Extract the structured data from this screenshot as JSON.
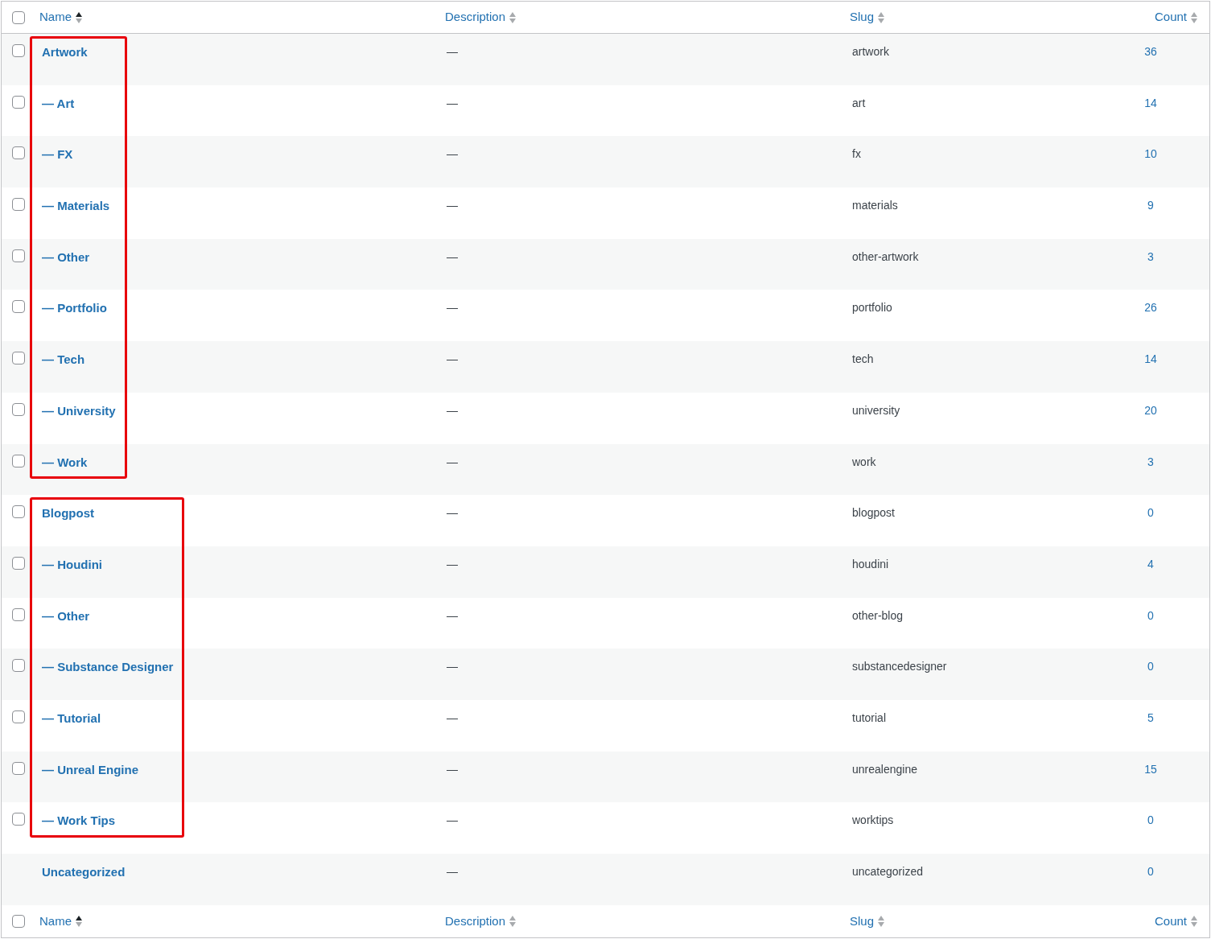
{
  "select_all": {
    "checked": false
  },
  "columns": [
    {
      "label": "Name",
      "sorted": true
    },
    {
      "label": "Description",
      "sorted": false
    },
    {
      "label": "Slug",
      "sorted": false
    },
    {
      "label": "Count",
      "sorted": false
    }
  ],
  "rows": [
    {
      "name": "Artwork",
      "description": "—",
      "slug": "artwork",
      "count": "36",
      "checked": false,
      "highlighted": true,
      "children": [
        {
          "name": "— Art",
          "description": "—",
          "slug": "art",
          "count": "14",
          "checked": false
        },
        {
          "name": "— FX",
          "description": "—",
          "slug": "fx",
          "count": "10",
          "checked": false
        },
        {
          "name": "— Materials",
          "description": "—",
          "slug": "materials",
          "count": "9",
          "checked": false
        },
        {
          "name": "— Other",
          "description": "—",
          "slug": "other-artwork",
          "count": "3",
          "checked": false
        },
        {
          "name": "— Portfolio",
          "description": "—",
          "slug": "portfolio",
          "count": "26",
          "checked": false
        },
        {
          "name": "— Tech",
          "description": "—",
          "slug": "tech",
          "count": "14",
          "checked": false
        },
        {
          "name": "— University",
          "description": "—",
          "slug": "university",
          "count": "20",
          "checked": false
        },
        {
          "name": "— Work",
          "description": "—",
          "slug": "work",
          "count": "3",
          "checked": false
        }
      ]
    },
    {
      "name": "Blogpost",
      "description": "—",
      "slug": "blogpost",
      "count": "0",
      "checked": false,
      "highlighted": true,
      "children": [
        {
          "name": "— Houdini",
          "description": "—",
          "slug": "houdini",
          "count": "4",
          "checked": false
        },
        {
          "name": "— Other",
          "description": "—",
          "slug": "other-blog",
          "count": "0",
          "checked": false
        },
        {
          "name": "— Substance Designer",
          "description": "—",
          "slug": "substancedesigner",
          "count": "0",
          "checked": false
        },
        {
          "name": "— Tutorial",
          "description": "—",
          "slug": "tutorial",
          "count": "5",
          "checked": false
        },
        {
          "name": "— Unreal Engine",
          "description": "—",
          "slug": "unrealengine",
          "count": "15",
          "checked": false
        },
        {
          "name": "— Work Tips",
          "description": "—",
          "slug": "worktips",
          "count": "0",
          "checked": false
        }
      ]
    },
    {
      "name": "Uncategorized",
      "description": "—",
      "slug": "uncategorized",
      "count": "0"
    }
  ],
  "footer_select_all": {
    "checked": false
  },
  "footer_columns": [
    {
      "label": "Name",
      "sorted": true
    },
    {
      "label": "Description",
      "sorted": false
    },
    {
      "label": "Slug",
      "sorted": false
    },
    {
      "label": "Count",
      "sorted": false
    }
  ]
}
